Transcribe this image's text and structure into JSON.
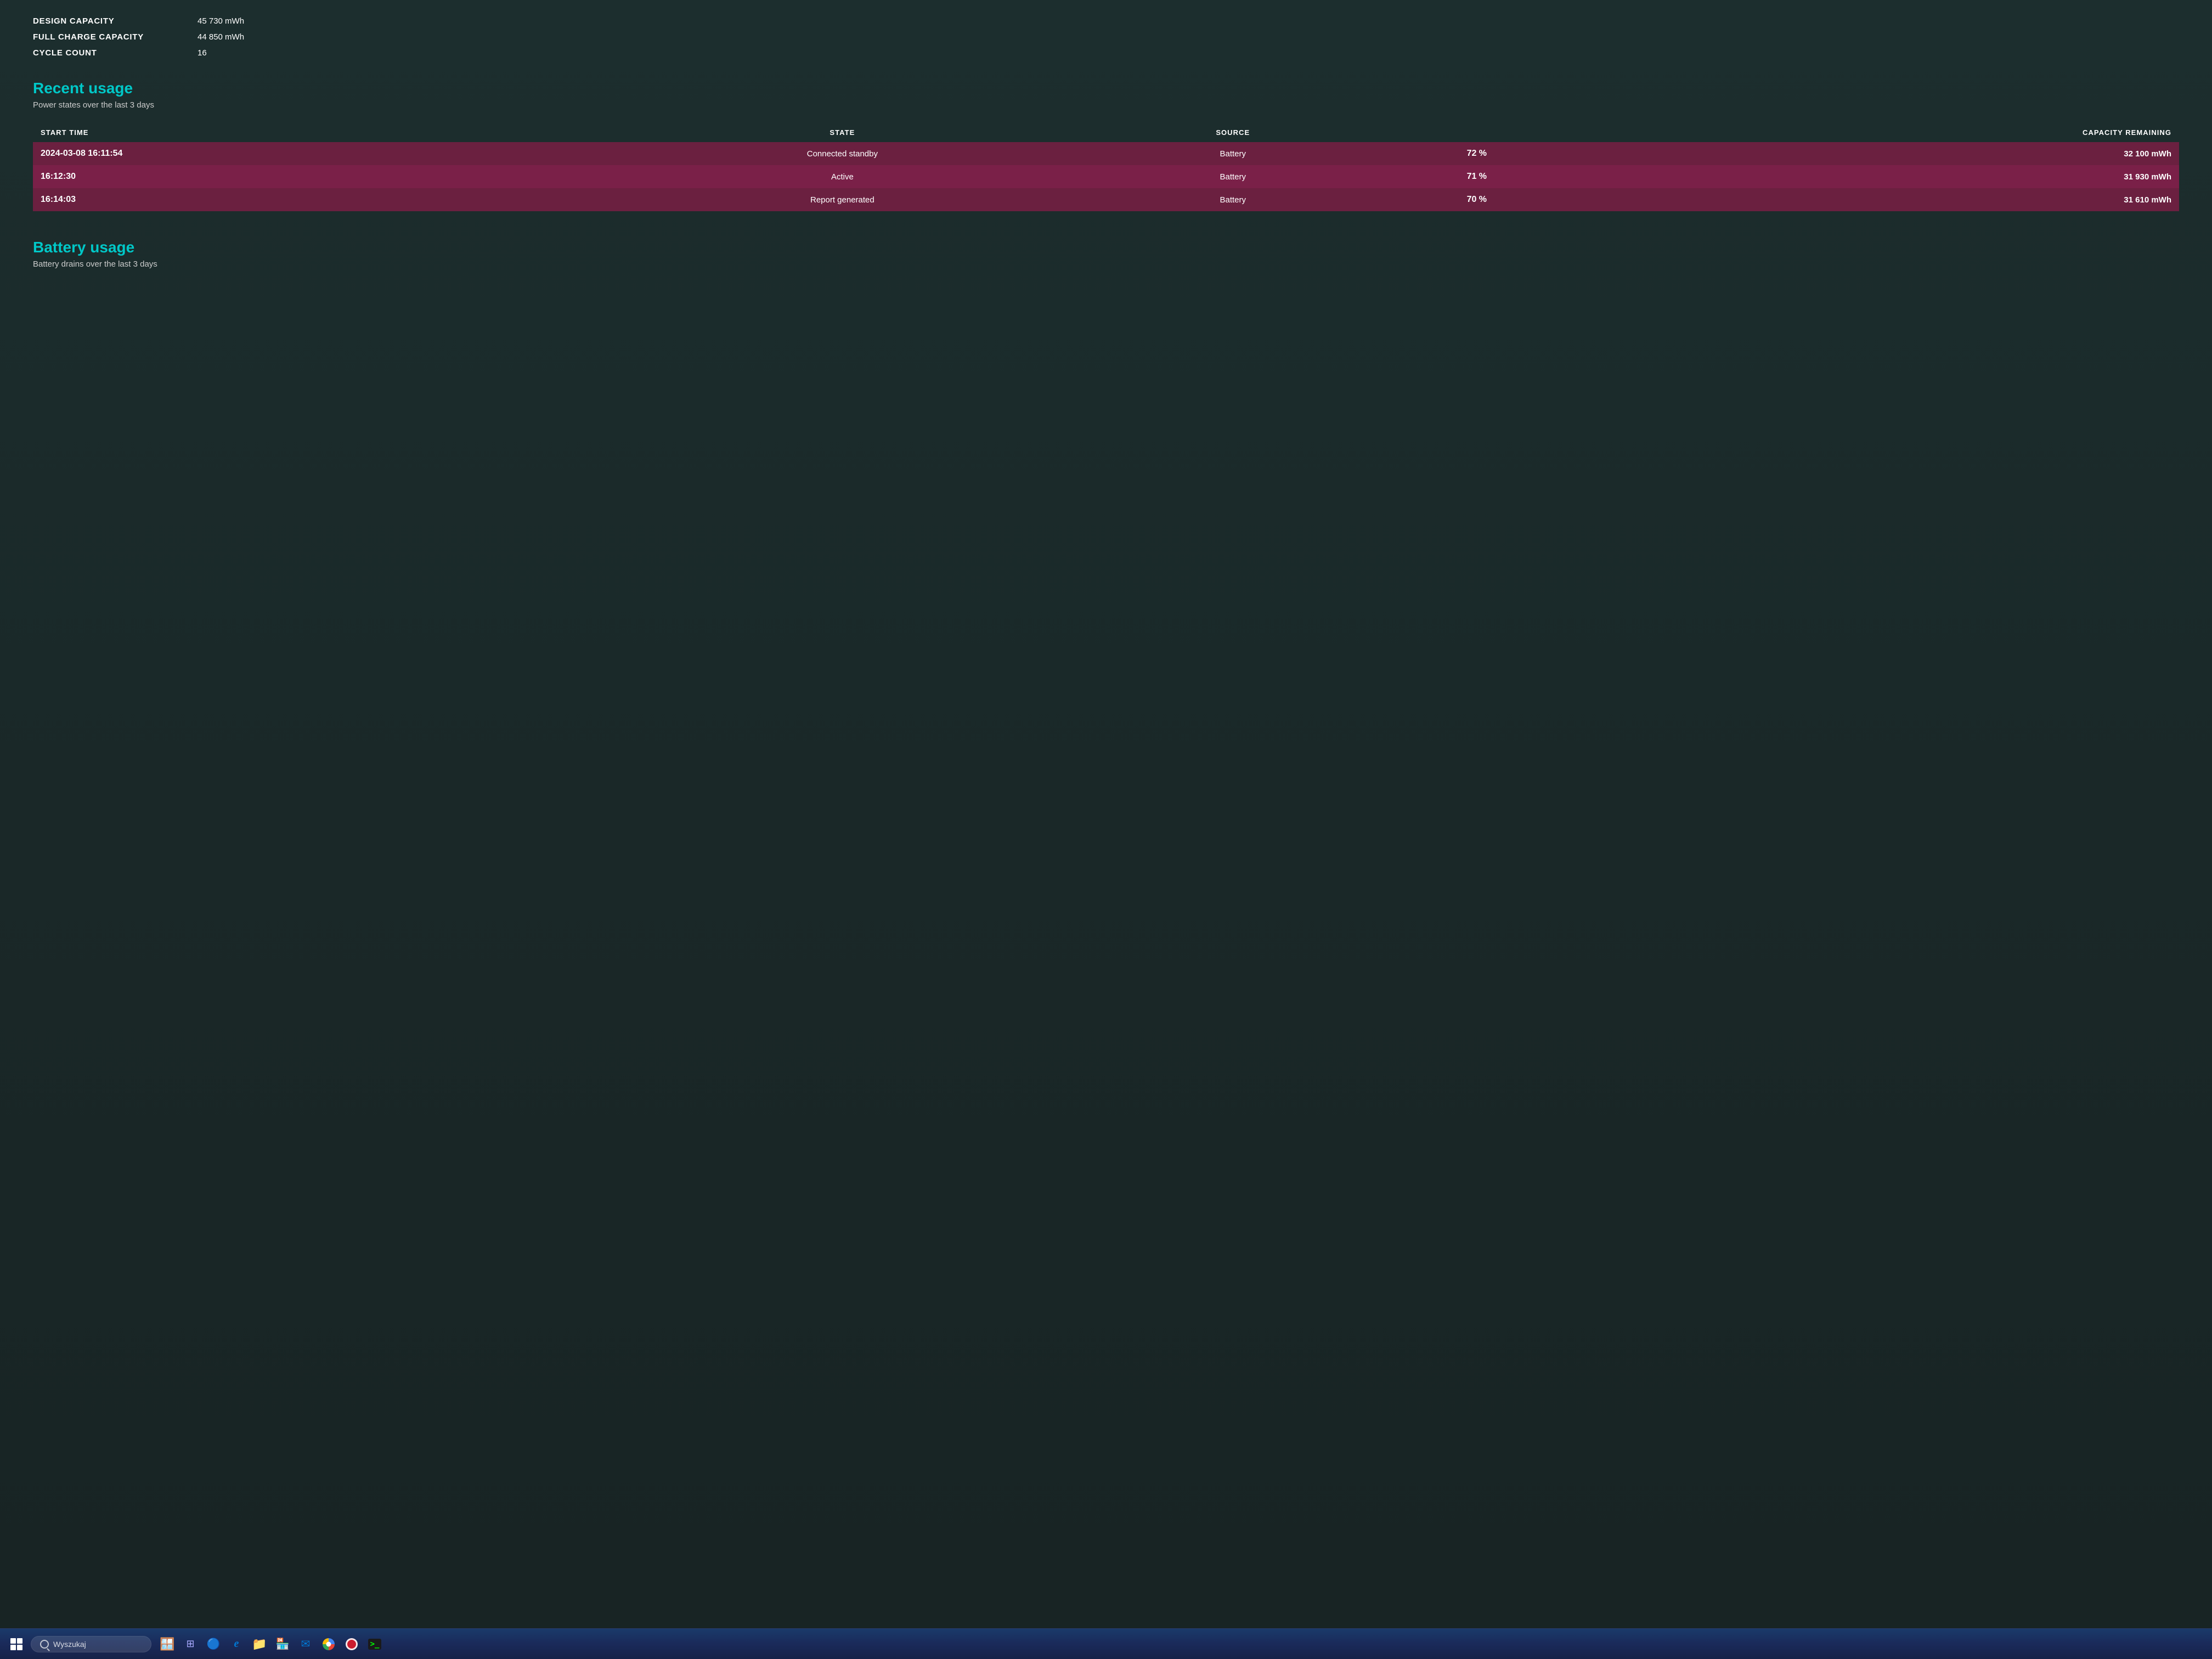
{
  "battery_info": {
    "design_capacity_label": "DESIGN CAPACITY",
    "design_capacity_value": "45 730 mWh",
    "full_charge_label": "FULL CHARGE CAPACITY",
    "full_charge_value": "44 850 mWh",
    "cycle_count_label": "CYCLE COUNT",
    "cycle_count_value": "16"
  },
  "recent_usage": {
    "title": "Recent usage",
    "subtitle": "Power states over the last 3 days",
    "table": {
      "headers": [
        "START TIME",
        "STATE",
        "SOURCE",
        "CAPACITY REMAINING",
        ""
      ],
      "col_headers": {
        "start_time": "START TIME",
        "state": "STATE",
        "source": "SOURCE",
        "capacity_pct": "",
        "capacity_mwh": "CAPACITY REMAINING"
      },
      "rows": [
        {
          "start_time": "2024-03-08  16:11:54",
          "state": "Connected standby",
          "source": "Battery",
          "capacity_pct": "72 %",
          "capacity_mwh": "32 100 mWh"
        },
        {
          "start_time": "16:12:30",
          "state": "Active",
          "source": "Battery",
          "capacity_pct": "71 %",
          "capacity_mwh": "31 930 mWh"
        },
        {
          "start_time": "16:14:03",
          "state": "Report generated",
          "source": "Battery",
          "capacity_pct": "70 %",
          "capacity_mwh": "31 610 mWh"
        }
      ]
    }
  },
  "battery_usage": {
    "title": "Battery usage",
    "subtitle": "Battery drains over the last 3 days"
  },
  "taskbar": {
    "search_placeholder": "Wyszukaj"
  }
}
